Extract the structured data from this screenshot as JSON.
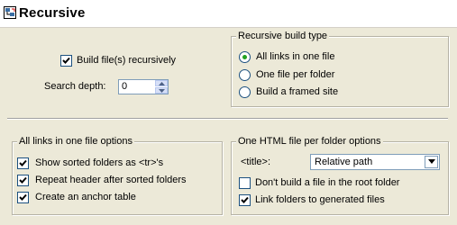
{
  "header": {
    "title": "Recursive",
    "icon": "recursive-tool-icon"
  },
  "build": {
    "recursive_checkbox": {
      "label": "Build file(s) recursively",
      "checked": true
    },
    "search_depth": {
      "label": "Search depth:",
      "value": "0"
    }
  },
  "build_type": {
    "title": "Recursive build type",
    "options": [
      {
        "label": "All links in one file",
        "selected": true
      },
      {
        "label": "One file per folder",
        "selected": false
      },
      {
        "label": "Build a framed site",
        "selected": false
      }
    ]
  },
  "one_file_options": {
    "title": "All links in one file options",
    "checkboxes": [
      {
        "label": "Show sorted folders as <tr>'s",
        "checked": true
      },
      {
        "label": "Repeat header after sorted folders",
        "checked": true
      },
      {
        "label": "Create an anchor table",
        "checked": true
      }
    ]
  },
  "per_folder_options": {
    "title": "One HTML file per folder options",
    "title_field": {
      "label": "<title>:",
      "value": "Relative path"
    },
    "checkboxes": [
      {
        "label": "Don't build a file in the root folder",
        "checked": false
      },
      {
        "label": "Link folders to generated files",
        "checked": true
      }
    ]
  },
  "colors": {
    "background": "#ece9d8",
    "header_bg": "#ffffff",
    "check_green": "#21a121",
    "control_border": "#1c5180"
  }
}
